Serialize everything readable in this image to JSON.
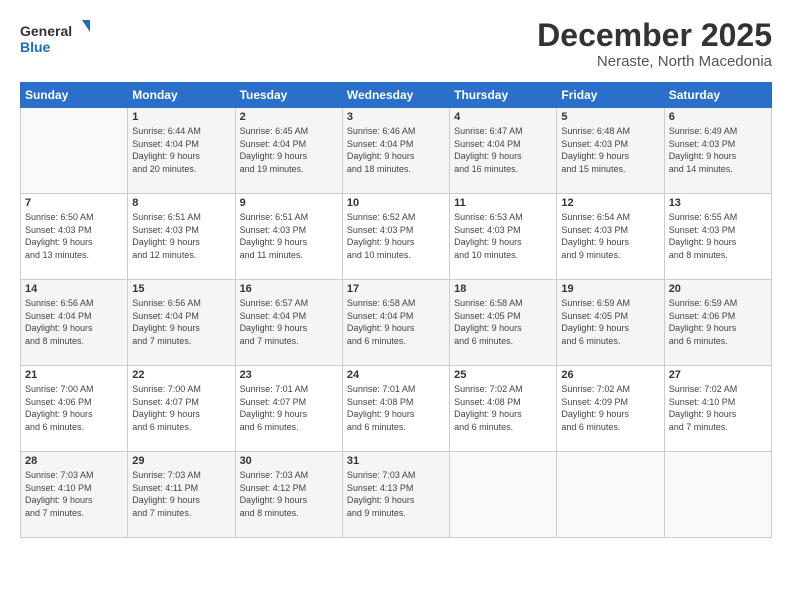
{
  "logo": {
    "line1": "General",
    "line2": "Blue"
  },
  "title": "December 2025",
  "location": "Neraste, North Macedonia",
  "days_header": [
    "Sunday",
    "Monday",
    "Tuesday",
    "Wednesday",
    "Thursday",
    "Friday",
    "Saturday"
  ],
  "weeks": [
    [
      {
        "day": "",
        "info": ""
      },
      {
        "day": "1",
        "info": "Sunrise: 6:44 AM\nSunset: 4:04 PM\nDaylight: 9 hours\nand 20 minutes."
      },
      {
        "day": "2",
        "info": "Sunrise: 6:45 AM\nSunset: 4:04 PM\nDaylight: 9 hours\nand 19 minutes."
      },
      {
        "day": "3",
        "info": "Sunrise: 6:46 AM\nSunset: 4:04 PM\nDaylight: 9 hours\nand 18 minutes."
      },
      {
        "day": "4",
        "info": "Sunrise: 6:47 AM\nSunset: 4:04 PM\nDaylight: 9 hours\nand 16 minutes."
      },
      {
        "day": "5",
        "info": "Sunrise: 6:48 AM\nSunset: 4:03 PM\nDaylight: 9 hours\nand 15 minutes."
      },
      {
        "day": "6",
        "info": "Sunrise: 6:49 AM\nSunset: 4:03 PM\nDaylight: 9 hours\nand 14 minutes."
      }
    ],
    [
      {
        "day": "7",
        "info": "Sunrise: 6:50 AM\nSunset: 4:03 PM\nDaylight: 9 hours\nand 13 minutes."
      },
      {
        "day": "8",
        "info": "Sunrise: 6:51 AM\nSunset: 4:03 PM\nDaylight: 9 hours\nand 12 minutes."
      },
      {
        "day": "9",
        "info": "Sunrise: 6:51 AM\nSunset: 4:03 PM\nDaylight: 9 hours\nand 11 minutes."
      },
      {
        "day": "10",
        "info": "Sunrise: 6:52 AM\nSunset: 4:03 PM\nDaylight: 9 hours\nand 10 minutes."
      },
      {
        "day": "11",
        "info": "Sunrise: 6:53 AM\nSunset: 4:03 PM\nDaylight: 9 hours\nand 10 minutes."
      },
      {
        "day": "12",
        "info": "Sunrise: 6:54 AM\nSunset: 4:03 PM\nDaylight: 9 hours\nand 9 minutes."
      },
      {
        "day": "13",
        "info": "Sunrise: 6:55 AM\nSunset: 4:03 PM\nDaylight: 9 hours\nand 8 minutes."
      }
    ],
    [
      {
        "day": "14",
        "info": "Sunrise: 6:56 AM\nSunset: 4:04 PM\nDaylight: 9 hours\nand 8 minutes."
      },
      {
        "day": "15",
        "info": "Sunrise: 6:56 AM\nSunset: 4:04 PM\nDaylight: 9 hours\nand 7 minutes."
      },
      {
        "day": "16",
        "info": "Sunrise: 6:57 AM\nSunset: 4:04 PM\nDaylight: 9 hours\nand 7 minutes."
      },
      {
        "day": "17",
        "info": "Sunrise: 6:58 AM\nSunset: 4:04 PM\nDaylight: 9 hours\nand 6 minutes."
      },
      {
        "day": "18",
        "info": "Sunrise: 6:58 AM\nSunset: 4:05 PM\nDaylight: 9 hours\nand 6 minutes."
      },
      {
        "day": "19",
        "info": "Sunrise: 6:59 AM\nSunset: 4:05 PM\nDaylight: 9 hours\nand 6 minutes."
      },
      {
        "day": "20",
        "info": "Sunrise: 6:59 AM\nSunset: 4:06 PM\nDaylight: 9 hours\nand 6 minutes."
      }
    ],
    [
      {
        "day": "21",
        "info": "Sunrise: 7:00 AM\nSunset: 4:06 PM\nDaylight: 9 hours\nand 6 minutes."
      },
      {
        "day": "22",
        "info": "Sunrise: 7:00 AM\nSunset: 4:07 PM\nDaylight: 9 hours\nand 6 minutes."
      },
      {
        "day": "23",
        "info": "Sunrise: 7:01 AM\nSunset: 4:07 PM\nDaylight: 9 hours\nand 6 minutes."
      },
      {
        "day": "24",
        "info": "Sunrise: 7:01 AM\nSunset: 4:08 PM\nDaylight: 9 hours\nand 6 minutes."
      },
      {
        "day": "25",
        "info": "Sunrise: 7:02 AM\nSunset: 4:08 PM\nDaylight: 9 hours\nand 6 minutes."
      },
      {
        "day": "26",
        "info": "Sunrise: 7:02 AM\nSunset: 4:09 PM\nDaylight: 9 hours\nand 6 minutes."
      },
      {
        "day": "27",
        "info": "Sunrise: 7:02 AM\nSunset: 4:10 PM\nDaylight: 9 hours\nand 7 minutes."
      }
    ],
    [
      {
        "day": "28",
        "info": "Sunrise: 7:03 AM\nSunset: 4:10 PM\nDaylight: 9 hours\nand 7 minutes."
      },
      {
        "day": "29",
        "info": "Sunrise: 7:03 AM\nSunset: 4:11 PM\nDaylight: 9 hours\nand 7 minutes."
      },
      {
        "day": "30",
        "info": "Sunrise: 7:03 AM\nSunset: 4:12 PM\nDaylight: 9 hours\nand 8 minutes."
      },
      {
        "day": "31",
        "info": "Sunrise: 7:03 AM\nSunset: 4:13 PM\nDaylight: 9 hours\nand 9 minutes."
      },
      {
        "day": "",
        "info": ""
      },
      {
        "day": "",
        "info": ""
      },
      {
        "day": "",
        "info": ""
      }
    ]
  ]
}
